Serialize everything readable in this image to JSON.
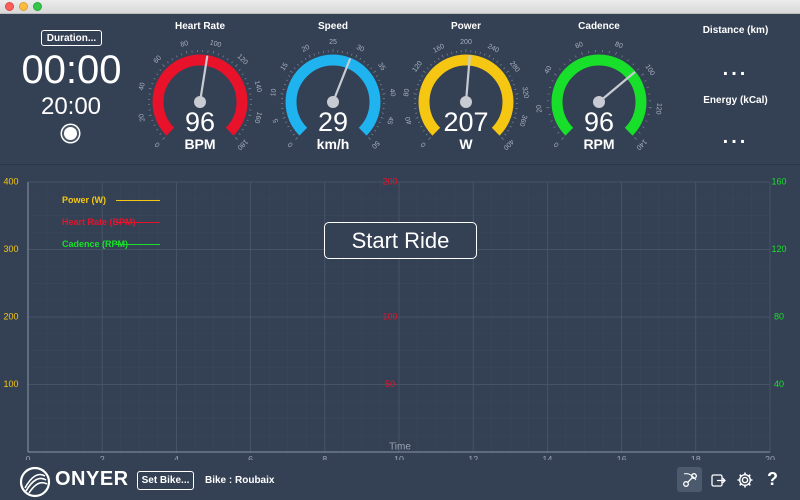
{
  "timer": {
    "duration_button": "Duration...",
    "elapsed": "00:00",
    "target": "20:00"
  },
  "gauges": [
    {
      "title": "Heart Rate",
      "value": "96",
      "unit": "BPM",
      "color": "#e8132b",
      "min": 0,
      "max": 180,
      "ticks": [
        "0",
        "20",
        "40",
        "60",
        "80",
        "100",
        "120",
        "140",
        "160",
        "180"
      ],
      "reading": 96
    },
    {
      "title": "Speed",
      "value": "29",
      "unit": "km/h",
      "color": "#1fb3f0",
      "min": 0,
      "max": 50,
      "ticks": [
        "0",
        "5",
        "10",
        "15",
        "20",
        "25",
        "30",
        "35",
        "40",
        "45",
        "50"
      ],
      "reading": 29
    },
    {
      "title": "Power",
      "value": "207",
      "unit": "W",
      "color": "#f5c712",
      "min": 0,
      "max": 400,
      "ticks": [
        "0",
        "40",
        "80",
        "120",
        "160",
        "200",
        "240",
        "280",
        "320",
        "360",
        "400"
      ],
      "reading": 207
    },
    {
      "title": "Cadence",
      "value": "96",
      "unit": "RPM",
      "color": "#18e02a",
      "min": 0,
      "max": 140,
      "ticks": [
        "0",
        "20",
        "40",
        "60",
        "80",
        "100",
        "120",
        "140"
      ],
      "reading": 96
    }
  ],
  "stats": {
    "distance_label": "Distance (km)",
    "distance_value": "...",
    "energy_label": "Energy (kCal)",
    "energy_value": "..."
  },
  "chart_data": {
    "type": "line",
    "xlabel": "Time",
    "x_ticks": [
      "0",
      "2",
      "4",
      "6",
      "8",
      "10",
      "12",
      "14",
      "16",
      "18",
      "20"
    ],
    "xlim": [
      0,
      20
    ],
    "y_axes": [
      {
        "name": "Power (W)",
        "side": "left",
        "color": "#f5c712",
        "ylim": [
          0,
          400
        ],
        "ticks": [
          "100",
          "200",
          "300",
          "400"
        ]
      },
      {
        "name": "Heart Rate (BPM)",
        "side": "center",
        "color": "#e8132b",
        "ylim": [
          0,
          200
        ],
        "ticks": [
          "50",
          "100",
          "200"
        ]
      },
      {
        "name": "Cadence (RPM)",
        "side": "right",
        "color": "#18e02a",
        "ylim": [
          0,
          160
        ],
        "ticks": [
          "40",
          "80",
          "120",
          "160"
        ]
      }
    ],
    "series": [
      {
        "name": "Power (W)",
        "color": "#f5c712",
        "values": []
      },
      {
        "name": "Heart Rate (BPM)",
        "color": "#e8132b",
        "values": []
      },
      {
        "name": "Cadence (RPM)",
        "color": "#18e02a",
        "values": []
      }
    ],
    "grid": true,
    "legend_position": "top-left"
  },
  "start_ride_label": "Start Ride",
  "bottom": {
    "logo_text": "ONYER",
    "set_bike_label": "Set Bike...",
    "bike_name": "Bike : Roubaix",
    "help_label": "?"
  }
}
